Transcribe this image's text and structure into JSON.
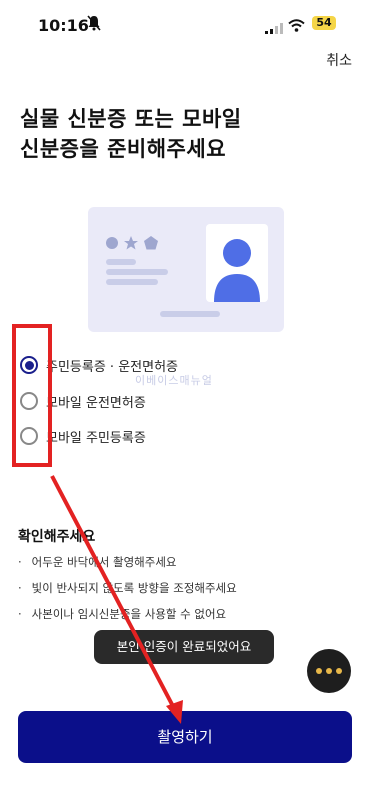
{
  "status": {
    "time": "10:16",
    "battery": "54"
  },
  "header": {
    "cancel_label": "취소"
  },
  "title": {
    "line1": "실물 신분증 또는 모바일",
    "line2": "신분증을 준비해주세요"
  },
  "options": [
    {
      "label": "주민등록증 · 운전면허증",
      "selected": true
    },
    {
      "label": "모바일 운전면허증",
      "selected": false
    },
    {
      "label": "모바일 주민등록증",
      "selected": false
    }
  ],
  "watermark": "이베이스매뉴얼",
  "checklist": {
    "title": "확인해주세요",
    "items": [
      "어두운 바닥에서 촬영해주세요",
      "빛이 반사되지 않도록 방향을 조정해주세요",
      "사본이나 임시신분증을 사용할 수 없어요"
    ]
  },
  "toast": "본인 인증이 완료되었어요",
  "primary_button": "촬영하기",
  "colors": {
    "primary": "#0b0f8a",
    "annotation": "#e32222"
  }
}
